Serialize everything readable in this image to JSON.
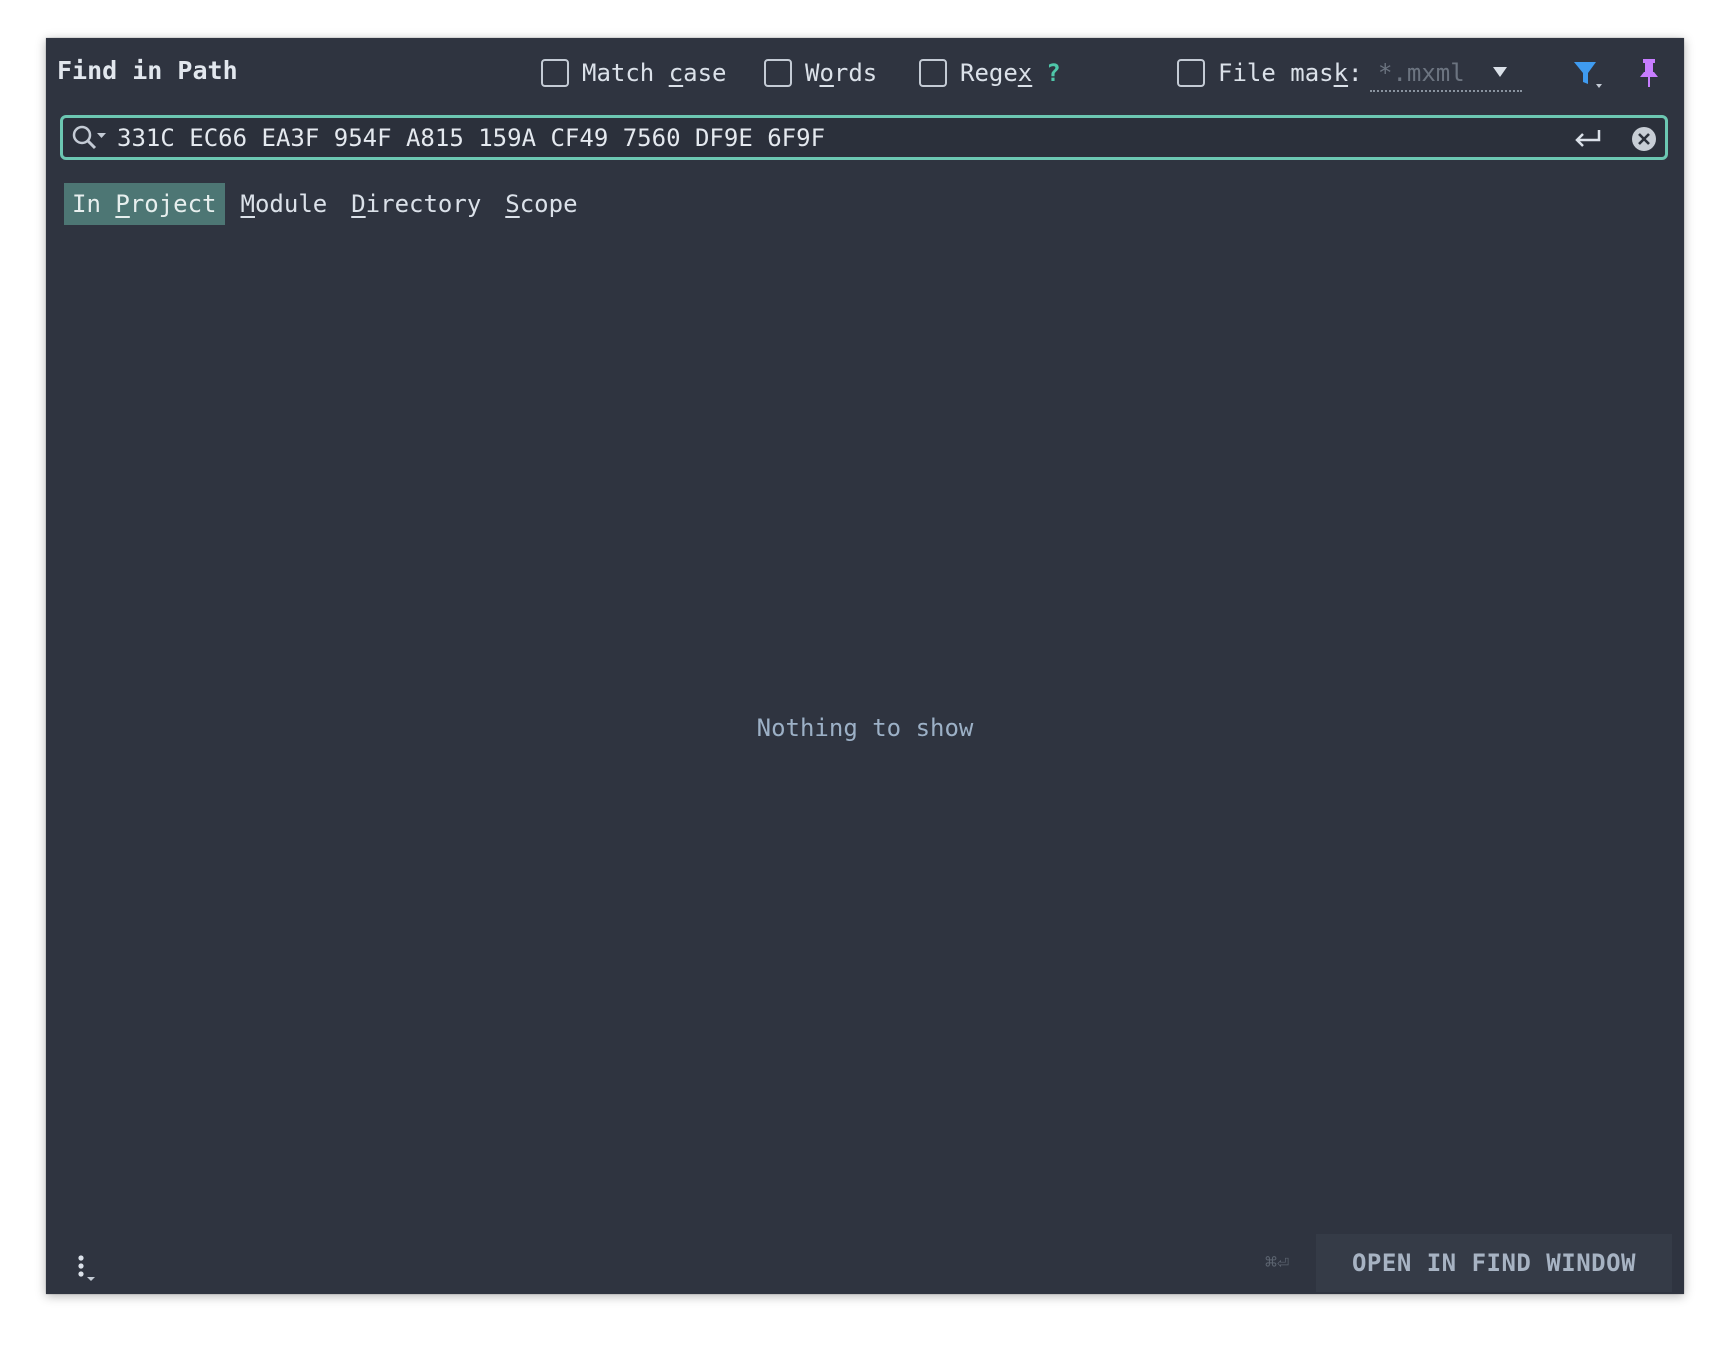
{
  "window": {
    "title": "Find in Path"
  },
  "options": {
    "match_case": {
      "pre": "Match ",
      "u": "c",
      "post": "ase",
      "checked": false
    },
    "words": {
      "pre": "W",
      "u": "o",
      "post": "rds",
      "checked": false
    },
    "regex": {
      "pre": "Rege",
      "u": "x",
      "post": "",
      "help": "?",
      "checked": false
    },
    "file_mask": {
      "pre": "File mas",
      "u": "k",
      "post": ":",
      "checked": false,
      "value": "*.mxml"
    }
  },
  "search": {
    "query": "331C EC66 EA3F 954F A815 159A CF49 7560 DF9E 6F9F"
  },
  "scopes": [
    {
      "pre": "In ",
      "u": "P",
      "post": "roject",
      "active": true
    },
    {
      "pre": "",
      "u": "M",
      "post": "odule",
      "active": false
    },
    {
      "pre": "",
      "u": "D",
      "post": "irectory",
      "active": false
    },
    {
      "pre": "",
      "u": "S",
      "post": "cope",
      "active": false
    }
  ],
  "results": {
    "empty_text": "Nothing to show"
  },
  "footer": {
    "shortcut": "⌘⏎",
    "open_button": "OPEN IN FIND WINDOW"
  },
  "icons": {
    "search": "search-icon",
    "filter": "filter-icon",
    "pin": "pin-icon",
    "enter": "enter-icon",
    "clear": "clear-icon",
    "more": "more-options-icon"
  },
  "colors": {
    "accent": "#6cc7b2",
    "active_scope": "#4d7674",
    "filter": "#3f9bf0",
    "pin": "#c77dff",
    "help": "#4fc6a9"
  }
}
